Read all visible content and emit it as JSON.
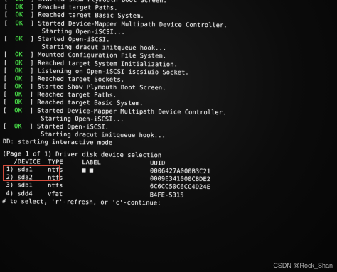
{
  "ok_label": "OK",
  "boot_log": [
    {
      "status": "OK",
      "text": "Started Show Plymouth Boot Screen."
    },
    {
      "status": "OK",
      "text": "Reached target Paths."
    },
    {
      "status": "OK",
      "text": "Reached target Basic System."
    },
    {
      "status": "OK",
      "text": "Started Device-Mapper Multipath Device Controller."
    },
    {
      "status": "",
      "text": "Starting Open-iSCSI..."
    },
    {
      "status": "OK",
      "text": "Started Open-iSCSI."
    },
    {
      "status": "",
      "text": "Starting dracut initqueue hook..."
    },
    {
      "status": "OK",
      "text": "Mounted Configuration File System."
    },
    {
      "status": "OK",
      "text": "Reached target System Initialization."
    },
    {
      "status": "OK",
      "text": "Listening on Open-iSCSI iscsiuio Socket."
    },
    {
      "status": "OK",
      "text": "Reached target Sockets."
    },
    {
      "status": "OK",
      "text": "Started Show Plymouth Boot Screen."
    },
    {
      "status": "OK",
      "text": "Reached target Paths."
    },
    {
      "status": "OK",
      "text": "Reached target Basic System."
    },
    {
      "status": "OK",
      "text": "Started Device-Mapper Multipath Device Controller."
    },
    {
      "status": "",
      "text": "Starting Open-iSCSI..."
    },
    {
      "status": "OK",
      "text": "Started Open-iSCSI."
    },
    {
      "status": "",
      "text": "Starting dracut initqueue hook..."
    }
  ],
  "dracut_message": "DD: starting interactive mode",
  "driver_selection": {
    "page_title": "(Page 1 of 1) Driver disk device selection",
    "headers": {
      "device": "/DEVICE",
      "type": "TYPE",
      "label": "LABEL",
      "uuid": "UUID"
    },
    "rows": [
      {
        "index": "1)",
        "device": "sda1",
        "type": "ntfs",
        "label": "■ ■",
        "uuid": "0006427A000B3C21"
      },
      {
        "index": "2)",
        "device": "sda2",
        "type": "ntfs",
        "label": "",
        "uuid": "0009E341000CBDE2"
      },
      {
        "index": "3)",
        "device": "sdb1",
        "type": "ntfs",
        "label": "",
        "uuid": "6C6CC50C6CC4D24E"
      },
      {
        "index": "4)",
        "device": "sdd4",
        "type": "vfat",
        "label": "",
        "uuid": "B4FE-5315"
      }
    ],
    "prompt": "# to select, 'r'-refresh, or 'c'-continue:"
  },
  "watermark": "CSDN @Rock_Shan",
  "colors": {
    "ok_green": "#4be04b",
    "text": "#e9e9e9",
    "highlight_border": "#d24a3a",
    "background": "#0b0b0b"
  }
}
